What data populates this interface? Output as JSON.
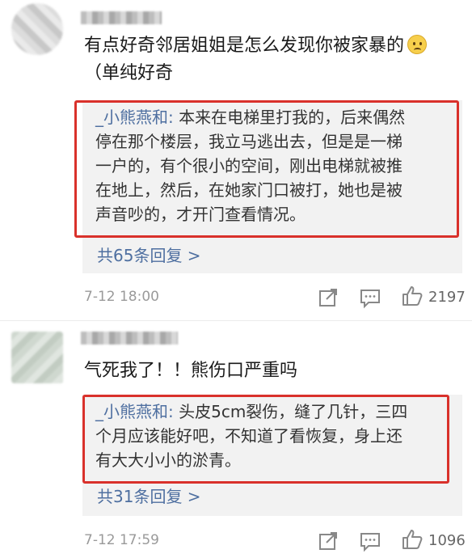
{
  "comments": [
    {
      "text_line1": "有点好奇邻居姐姐是怎么发现你被家暴的",
      "text_line2": "（单纯好奇",
      "reply": {
        "author": "_小熊燕和:",
        "lines": [
          " 本来在电梯里打我的，后来偶然",
          "停在那个楼层，我立马逃出去，但是是一梯",
          "一户的，有个很小的空间，刚出电梯就被推",
          "在地上，然后，在她家门口被打，她也是被",
          "声音吵的，才开门查看情况。"
        ],
        "more": "共65条回复 >"
      },
      "timestamp": "7-12 18:00",
      "likes": "2197"
    },
    {
      "text_line1": "气死我了！！熊伤口严重吗",
      "reply": {
        "author": "_小熊燕和:",
        "lines": [
          " 头皮5cm裂伤，缝了几针，三四",
          "个月应该能好吧，不知道了看恢复，身上还",
          "有大大小小的淤青。"
        ],
        "more": "共31条回复 >"
      },
      "timestamp": "7-12 17:59",
      "likes": "1096"
    }
  ],
  "icons": [
    "share-icon",
    "comment-icon",
    "like-icon",
    "smiley-worried-icon"
  ],
  "colors": {
    "highlight": "#d9312b",
    "link": "#4e6fa0",
    "reply_bg": "#f2f2f2"
  }
}
